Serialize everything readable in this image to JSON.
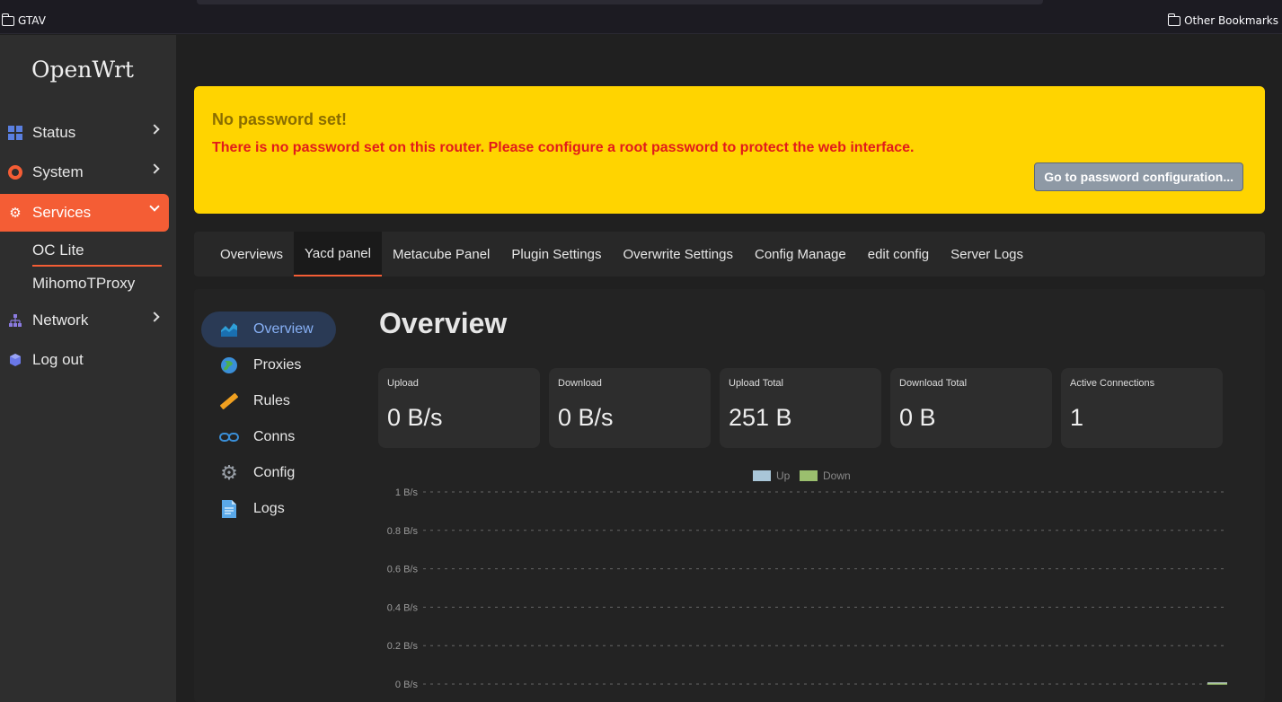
{
  "bookmarks": {
    "left": "GTAV",
    "right": "Other Bookmarks"
  },
  "sidebar": {
    "brand": "OpenWrt",
    "items": [
      {
        "label": "Status",
        "icon": "dashboard-icon"
      },
      {
        "label": "System",
        "icon": "gear-icon"
      },
      {
        "label": "Services",
        "icon": "cogs-icon",
        "active": true
      },
      {
        "label": "Network",
        "icon": "sitemap-icon"
      },
      {
        "label": "Log out",
        "icon": "cube-icon"
      }
    ],
    "subitems": [
      "OC Lite",
      "MihomoTProxy"
    ]
  },
  "alert": {
    "title": "No password set!",
    "message": "There is no password set on this router. Please configure a root password to protect the web interface.",
    "button": "Go to password configuration..."
  },
  "tabs": [
    "Overviews",
    "Yacd panel",
    "Metacube Panel",
    "Plugin Settings",
    "Overwrite Settings",
    "Config Manage",
    "edit config",
    "Server Logs"
  ],
  "active_tab": "Yacd panel",
  "yacd": {
    "nav": [
      "Overview",
      "Proxies",
      "Rules",
      "Conns",
      "Config",
      "Logs"
    ],
    "title": "Overview",
    "cards": [
      {
        "label": "Upload",
        "value": "0 B/s"
      },
      {
        "label": "Download",
        "value": "0 B/s"
      },
      {
        "label": "Upload Total",
        "value": "251 B"
      },
      {
        "label": "Download Total",
        "value": "0 B"
      },
      {
        "label": "Active Connections",
        "value": "1"
      }
    ]
  },
  "colors": {
    "accent": "#f45d35",
    "alert_bg": "#ffd400",
    "alert_text": "#e21b1b",
    "up": "#a9c6d8",
    "down": "#9bbf6e"
  },
  "chart_data": {
    "type": "line",
    "series": [
      {
        "name": "Up",
        "values": [
          0
        ]
      },
      {
        "name": "Down",
        "values": [
          0
        ]
      }
    ],
    "y_ticks": [
      "1 B/s",
      "0.8 B/s",
      "0.6 B/s",
      "0.4 B/s",
      "0.2 B/s",
      "0 B/s"
    ],
    "ylim": [
      0,
      1
    ],
    "grid": true,
    "legend": "top"
  }
}
